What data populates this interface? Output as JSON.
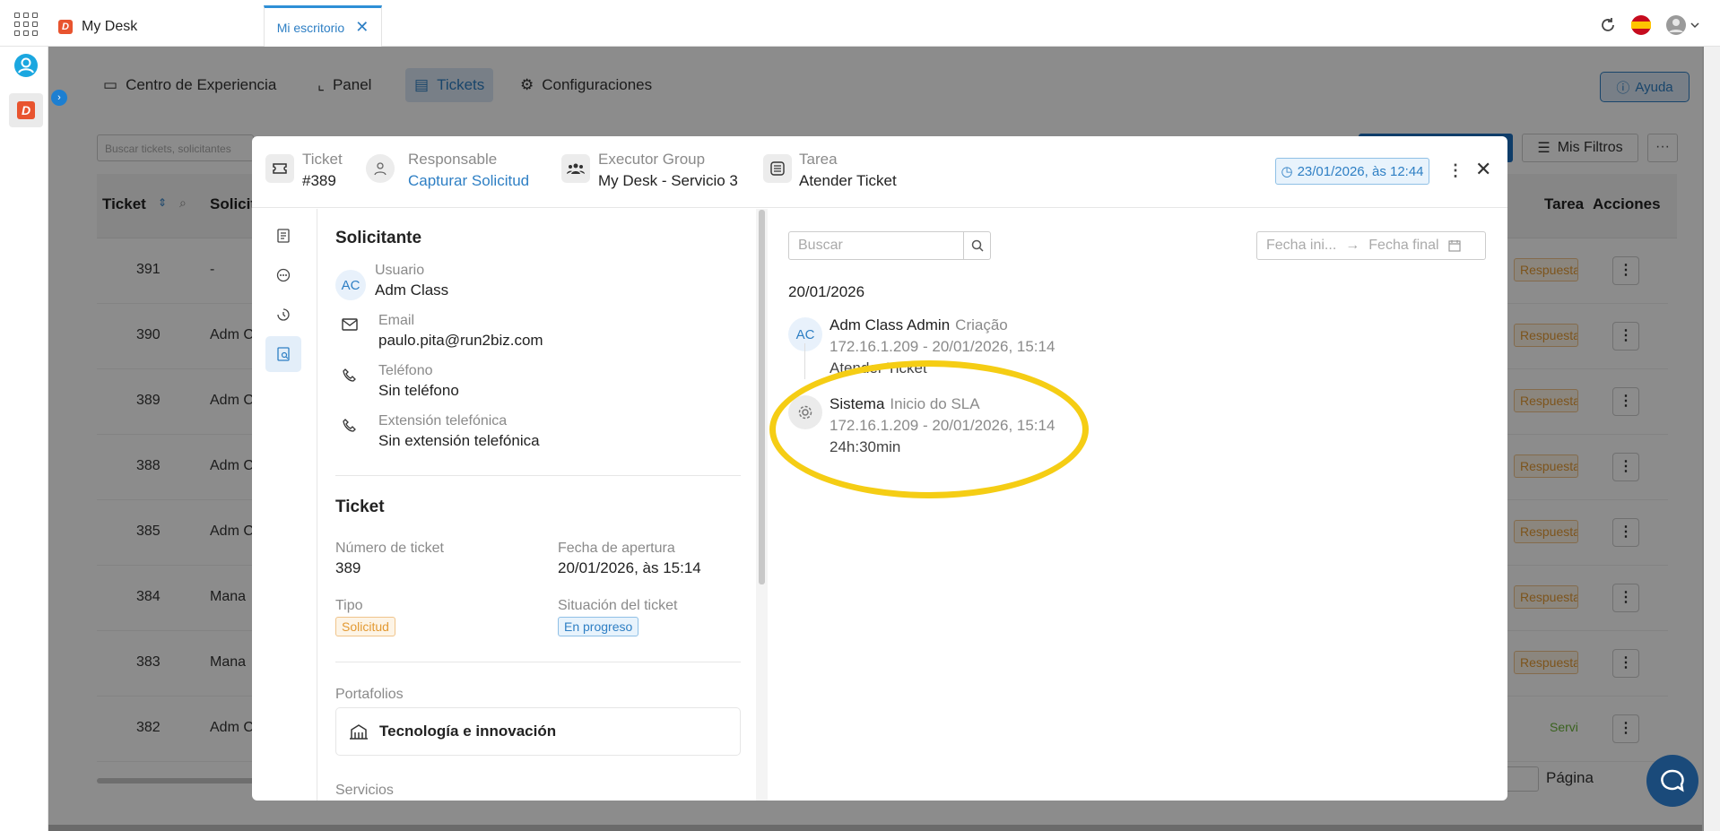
{
  "app": {
    "tab_title": "My Desk",
    "active_tab": "Mi escritorio",
    "close": "✕"
  },
  "nav": [
    "Centro de Experiencia",
    "Panel",
    "Tickets",
    "Configuraciones"
  ],
  "help": "Ayuda",
  "table": {
    "search_placeholder": "Buscar tickets, solicitantes",
    "filters": "Mis Filtros",
    "headers": {
      "ticket": "Ticket",
      "solicitante": "Solicit",
      "tarea": "Tarea",
      "acciones": "Acciones"
    },
    "rows": [
      {
        "num": "391",
        "sol": "-",
        "status": "Respuesta"
      },
      {
        "num": "390",
        "sol": "Adm C",
        "status": "Respuesta"
      },
      {
        "num": "389",
        "sol": "Adm C",
        "status": "Respuesta"
      },
      {
        "num": "388",
        "sol": "Adm C",
        "status": "Respuesta"
      },
      {
        "num": "385",
        "sol": "Adm C",
        "status": "Respuesta"
      },
      {
        "num": "384",
        "sol": "Mana",
        "status": "Respuesta"
      },
      {
        "num": "383",
        "sol": "Mana",
        "status": "Respuesta"
      },
      {
        "num": "382",
        "sol": "Adm C",
        "status": "Servi"
      }
    ],
    "pagina": "Página"
  },
  "modal": {
    "ticket_label": "Ticket",
    "ticket_value": "#389",
    "resp_label": "Responsable",
    "resp_value": "Capturar Solicitud",
    "group_label": "Executor Group",
    "group_value": "My Desk - Servicio 3",
    "task_label": "Tarea",
    "task_value": "Atender Ticket",
    "date_badge": "23/01/2026, às 12:44",
    "left": {
      "solicitante_title": "Solicitante",
      "user_initials": "AC",
      "user_label": "Usuario",
      "user_value": "Adm Class",
      "email_label": "Email",
      "email_value": "paulo.pita@run2biz.com",
      "phone_label": "Teléfono",
      "phone_value": "Sin teléfono",
      "ext_label": "Extensión telefónica",
      "ext_value": "Sin extensión telefónica",
      "ticket_title": "Ticket",
      "num_label": "Número de ticket",
      "num_value": "389",
      "open_label": "Fecha de apertura",
      "open_value": "20/01/2026, às 15:14",
      "type_label": "Tipo",
      "type_value": "Solicitud",
      "status_label": "Situación del ticket",
      "status_value": "En progreso",
      "portfolio_label": "Portafolios",
      "portfolio_value": "Tecnología e innovación",
      "services_label": "Servicios"
    },
    "right": {
      "search_placeholder": "Buscar",
      "date_start": "Fecha ini...",
      "date_arrow": "→",
      "date_end": "Fecha final",
      "date_group": "20/01/2026",
      "events": [
        {
          "initials": "AC",
          "name": "Adm Class Admin",
          "action": "Criação",
          "meta": "172.16.1.209 -  20/01/2026, 15:14",
          "desc": "Atender Ticket"
        },
        {
          "initials": "",
          "name": "Sistema",
          "action": "Inicio do SLA",
          "meta": "172.16.1.209 -  20/01/2026, 15:14",
          "desc": "24h:30min"
        }
      ]
    }
  }
}
